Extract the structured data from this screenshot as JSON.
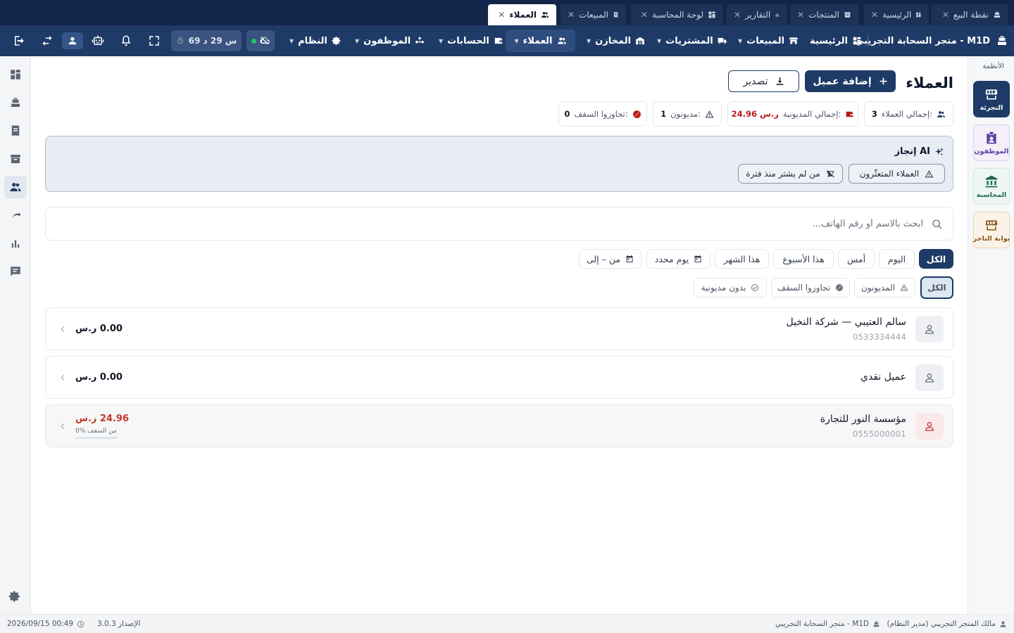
{
  "tabs": [
    {
      "label": "نقطة البيع",
      "icon": "pos-register-icon",
      "active": false
    },
    {
      "label": "الرئيسية",
      "icon": "dashboard-icon",
      "active": false
    },
    {
      "label": "المنتجات",
      "icon": "box-icon",
      "active": false
    },
    {
      "label": "التقارير",
      "icon": "bar-chart-icon",
      "active": false
    },
    {
      "label": "لوحة المحاسبة",
      "icon": "dashboard-icon",
      "active": false
    },
    {
      "label": "المبيعات",
      "icon": "receipt-icon",
      "active": false
    },
    {
      "label": "العملاء",
      "icon": "users-icon",
      "active": true
    }
  ],
  "tab_close": "✕",
  "nav": {
    "brand": "متجر السحابة التجريبي - M1D",
    "items": [
      {
        "label": "الرئيسية",
        "icon": "dashboard-icon"
      },
      {
        "label": "المبيعات",
        "icon": "store-icon"
      },
      {
        "label": "المشتريات",
        "icon": "truck-icon"
      },
      {
        "label": "المخازن",
        "icon": "warehouse-icon"
      },
      {
        "label": "العملاء",
        "icon": "users-icon",
        "active": true
      },
      {
        "label": "الحسابات",
        "icon": "wallet-icon"
      },
      {
        "label": "الموظفون",
        "icon": "staff-icon"
      },
      {
        "label": "النظام",
        "icon": "gear-icon"
      }
    ],
    "timer": "69 س 29 د"
  },
  "systems": {
    "title": "الأنظمة",
    "items": [
      {
        "label": "التجزئة",
        "icon": "retail-store-icon",
        "active": true
      },
      {
        "label": "الموظفون",
        "icon": "employee-badge-icon"
      },
      {
        "label": "المحاسبة",
        "icon": "bank-icon"
      },
      {
        "label": "بوابة التاجر",
        "icon": "merchant-store-icon"
      }
    ]
  },
  "page": {
    "title": "العملاء",
    "add_button": "إضافة عميل",
    "export_button": "تصدير"
  },
  "stats": [
    {
      "label": "إجمالي العملاء:",
      "value": "3",
      "icon": "users-icon"
    },
    {
      "label": "إجمالي المديونية:",
      "value": "24.96 ر.س",
      "icon": "wallet-icon",
      "color": "#b91c1c"
    },
    {
      "label": "مديونون:",
      "value": "1",
      "icon": "warning-icon"
    },
    {
      "label": "تجاوزوا السقف:",
      "value": "0",
      "icon": "block-icon",
      "color": "#b91c1c"
    }
  ],
  "ai": {
    "title": "إنجاز AI",
    "chips": [
      {
        "label": "العملاء المتعثّرون",
        "icon": "warning-icon"
      },
      {
        "label": "من لم يشتر منذ فترة",
        "icon": "cart-off-icon"
      }
    ]
  },
  "search": {
    "placeholder": "ابحث بالاسم أو رقم الهاتف..."
  },
  "date_filters": [
    {
      "label": "الكل",
      "active": true
    },
    {
      "label": "اليوم"
    },
    {
      "label": "أمس"
    },
    {
      "label": "هذا الأسبوع"
    },
    {
      "label": "هذا الشهر"
    },
    {
      "label": "يوم محدد",
      "icon": "calendar-icon"
    },
    {
      "label": "من – إلى",
      "icon": "calendar-icon"
    }
  ],
  "status_filters": [
    {
      "label": "الكل",
      "active": true
    },
    {
      "label": "المديونون",
      "icon": "warning-icon"
    },
    {
      "label": "تجاوزوا السقف",
      "icon": "block-icon"
    },
    {
      "label": "بدون مديونية",
      "icon": "check-circle-icon"
    }
  ],
  "customers": [
    {
      "name": "سالم العتيبي — شركة النخيل",
      "phone": "0533334444",
      "balance": "0.00 ر.س"
    },
    {
      "name": "عميل نقدي",
      "phone": "",
      "balance": "0.00 ر.س"
    },
    {
      "name": "مؤسسة النور للتجارة",
      "phone": "0555000001",
      "balance": "24.96 ر.س",
      "limit_text": "0% من السقف",
      "limit_fraction": 0.0,
      "debt": true
    }
  ],
  "footer": {
    "user": "مالك المتجر التجريبي (مدير النظام)",
    "store": "متجر السحابة التجريبي - M1D",
    "version": "الإصدار 3.0.3",
    "datetime": "2026/09/15 00:49"
  },
  "colors": {
    "primary": "#1e3a66",
    "tabbar": "#13254a",
    "debt": "#c0392b"
  }
}
